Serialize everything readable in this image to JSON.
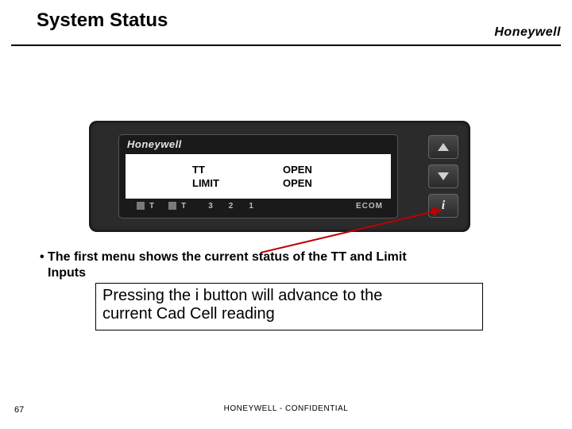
{
  "header": {
    "title": "System Status",
    "brand": "Honeywell"
  },
  "device": {
    "brand": "Honeywell",
    "lcd": [
      {
        "key": "TT",
        "value": "OPEN"
      },
      {
        "key": "LIMIT",
        "value": "OPEN"
      }
    ],
    "legend": {
      "t1": "T",
      "t2": "T",
      "nums": [
        "3",
        "2",
        "1"
      ],
      "ecom": "ECOM"
    },
    "buttons": {
      "info": "i"
    }
  },
  "body": {
    "bullet_line1": "The first menu shows the current status of the TT and Limit",
    "bullet_line2": "Inputs",
    "tip_line1": "Pressing the i button will advance to the",
    "tip_line2": "current Cad Cell reading"
  },
  "footer": {
    "text": "HONEYWELL - CONFIDENTIAL",
    "page": "67"
  }
}
